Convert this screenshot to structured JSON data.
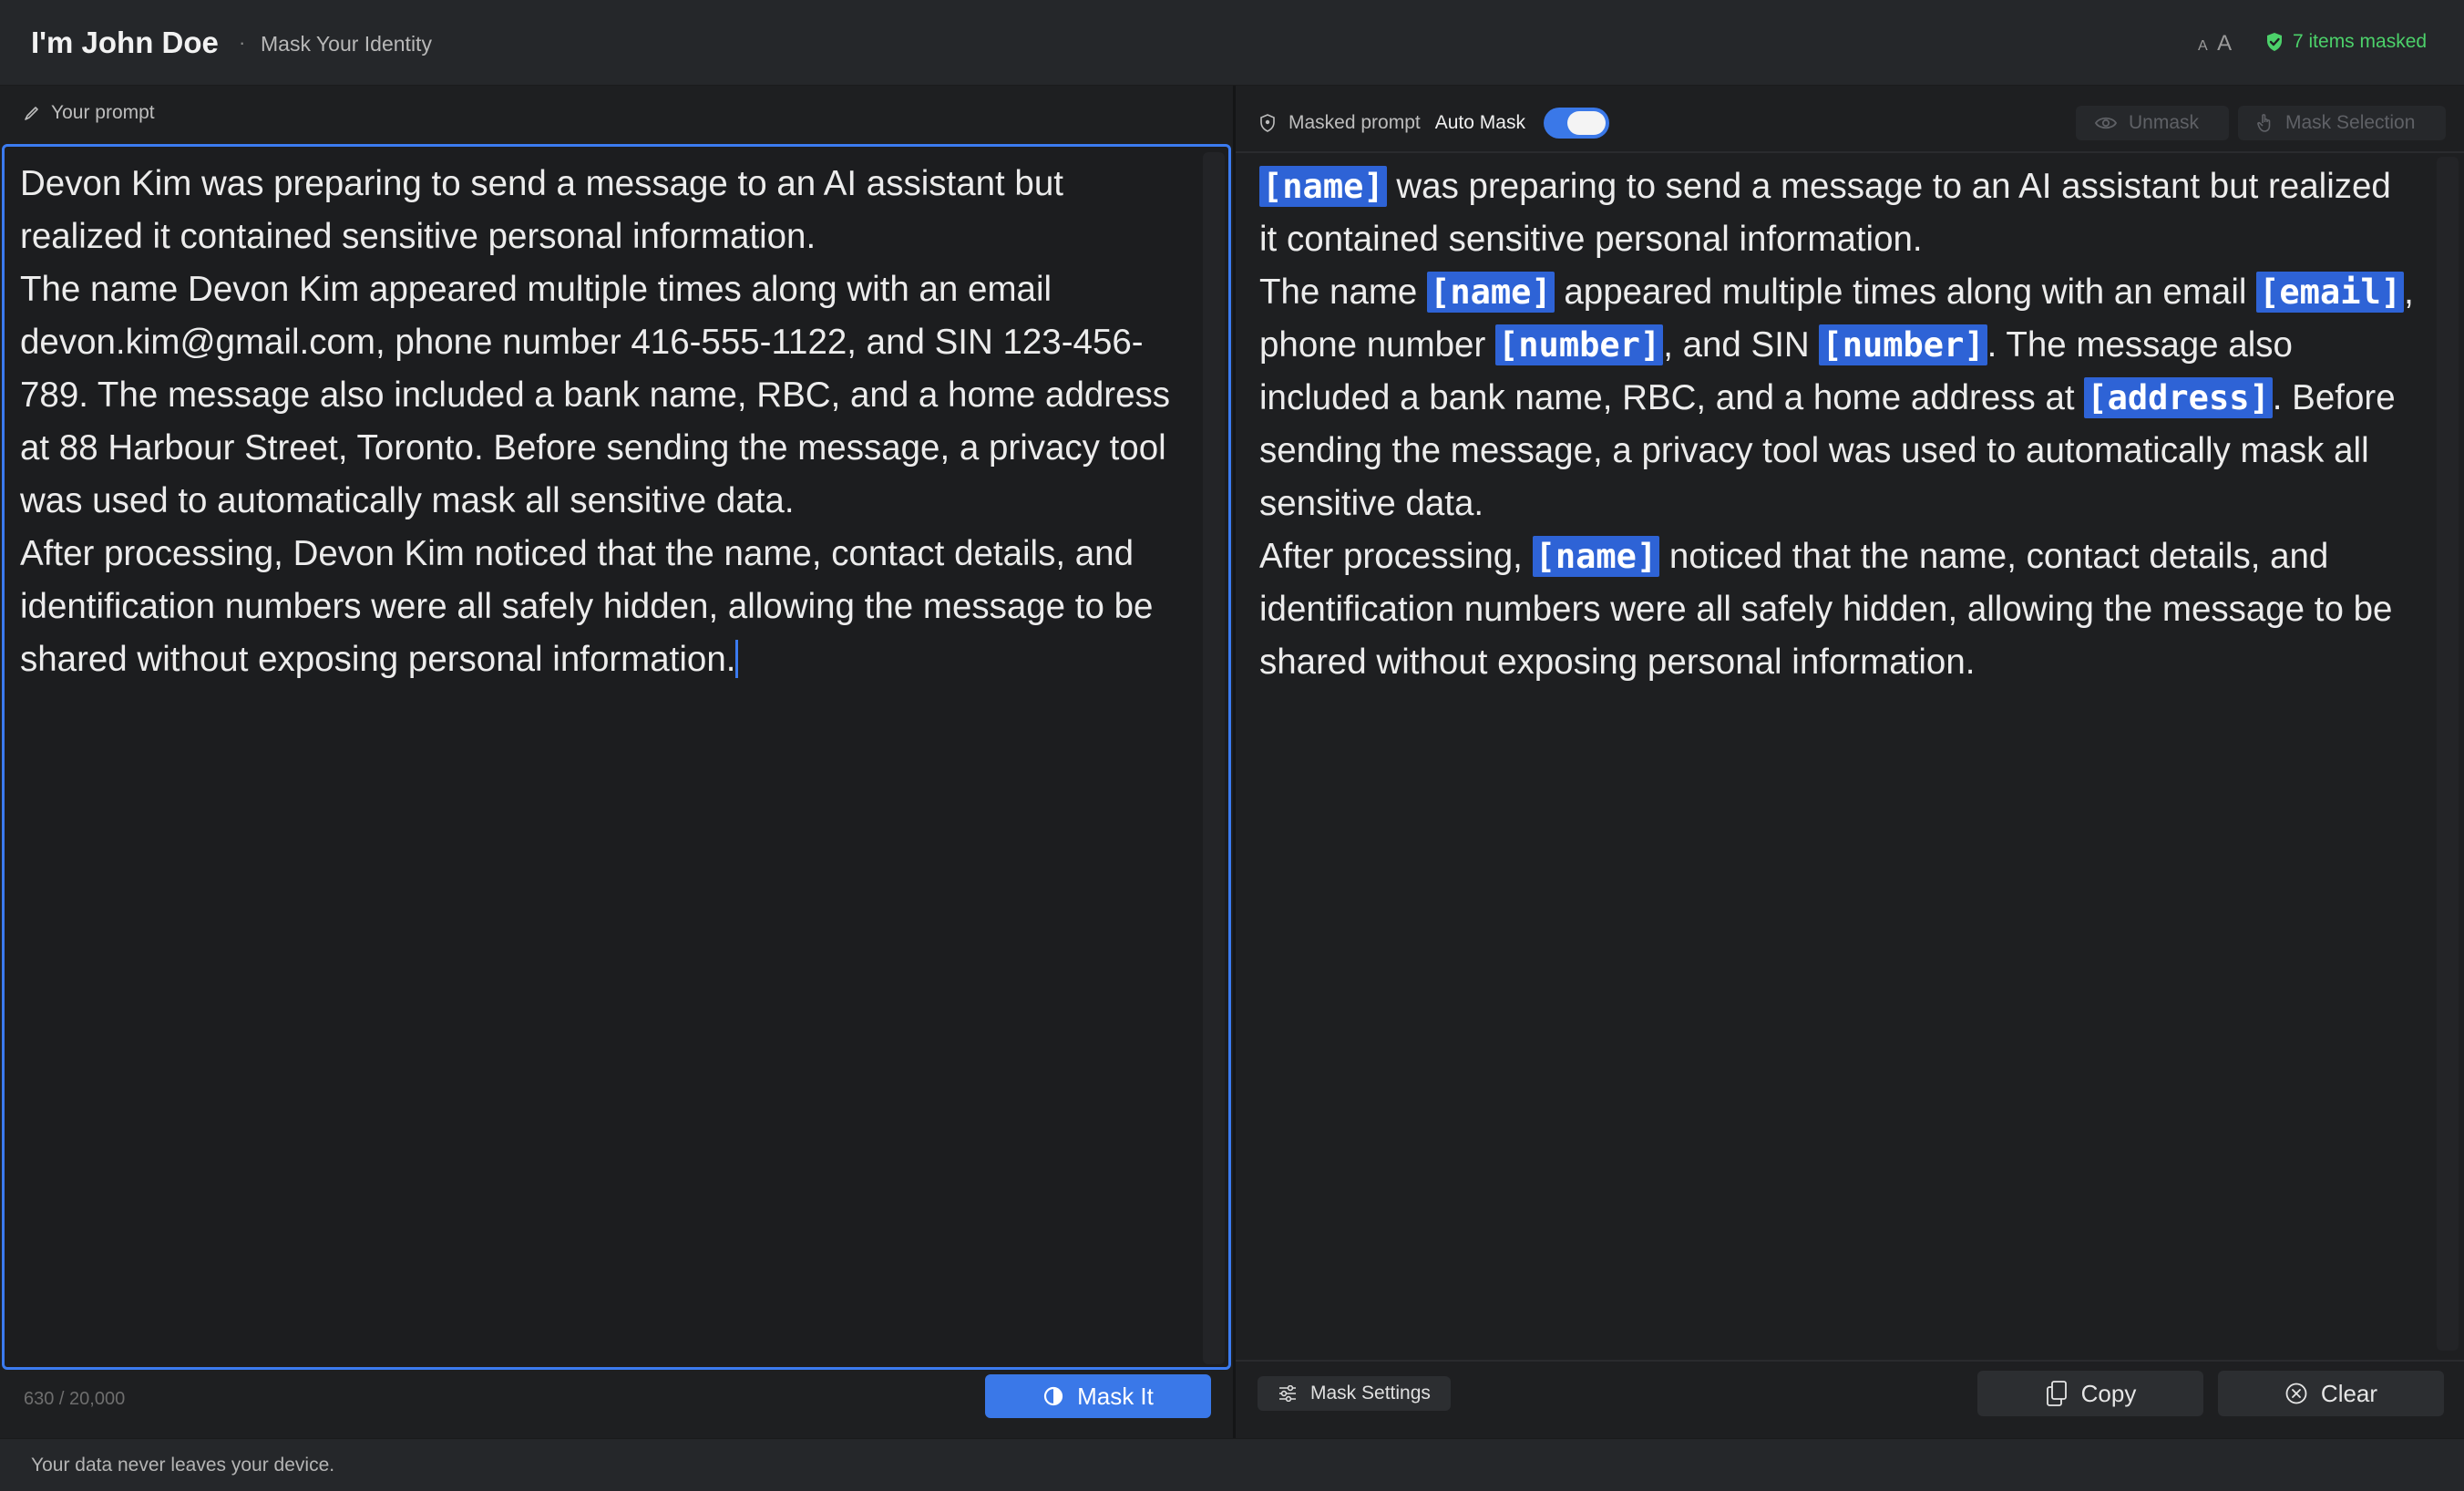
{
  "header": {
    "title": "I'm John Doe",
    "separator": "·",
    "subtitle": "Mask Your Identity",
    "font_small": "A",
    "font_large": "A",
    "masked_count": "7 items masked"
  },
  "left": {
    "label": "Your prompt",
    "icon": "pencil-icon",
    "paragraphs": [
      "Devon Kim was preparing to send a message to an AI assistant but realized it contained sensitive personal information.",
      "The name Devon Kim appeared multiple times along with an email devon.kim@gmail.com, phone number 416-555-1122, and SIN 123-456-789. The message also included a bank name, RBC, and a home address at 88 Harbour Street, Toronto. Before sending the message, a privacy tool was used to automatically mask all sensitive data.",
      "After processing, Devon Kim noticed that the name, contact details, and identification numbers were all safely hidden, allowing the message to be shared without exposing personal information."
    ],
    "char_count": "630 / 20,000",
    "mask_button": "Mask It"
  },
  "right": {
    "label": "Masked prompt",
    "automask_label": "Auto Mask",
    "automask_on": true,
    "unmask_button": "Unmask",
    "mask_selection_button": "Mask Selection",
    "output": {
      "p1_tag1": "[name]",
      "p1_text": " was preparing to send a message to an AI assistant but realized it contained sensitive personal information.",
      "p2_a": "The name ",
      "p2_tag1": "[name]",
      "p2_b": " appeared multiple times along with an email ",
      "p2_tag2": "[email]",
      "p2_c": ", phone number ",
      "p2_tag3": "[number]",
      "p2_d": ", and SIN ",
      "p2_tag4": "[number]",
      "p2_e": ". The message also included a bank name, RBC, and a home address at ",
      "p2_tag5": "[address]",
      "p2_f": ". Before sending the message, a privacy tool was used to automatically mask all sensitive data.",
      "p3_a": "After processing, ",
      "p3_tag1": "[name]",
      "p3_b": " noticed that the name, contact details, and identification numbers were all safely hidden, allowing the message to be shared without exposing personal information."
    },
    "settings_button": "Mask Settings",
    "copy_button": "Copy",
    "clear_button": "Clear"
  },
  "footer": {
    "text": "Your data never leaves your device."
  },
  "colors": {
    "accent": "#3a78e8",
    "tag_bg": "#2e63d6",
    "success": "#4cd16a",
    "background": "#1e1f21"
  }
}
